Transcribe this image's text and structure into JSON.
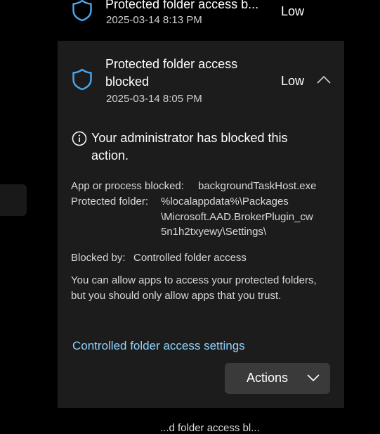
{
  "events": [
    {
      "title": "Protected folder access b...",
      "timestamp": "2025-03-14 8:13 PM",
      "severity": "Low",
      "icon": "shield-icon"
    },
    {
      "title": "Protected folder access blocked",
      "timestamp": "2025-03-14 8:05 PM",
      "severity": "Low",
      "icon": "shield-icon",
      "expanded": true
    }
  ],
  "detail": {
    "notice": "Your administrator has blocked this action.",
    "app_label": "App or process blocked:",
    "app_value": "backgroundTaskHost.exe",
    "folder_label": "Protected folder:",
    "folder_value_lines": [
      "%localappdata%\\Packages",
      "\\Microsoft.AAD.BrokerPlugin_cw",
      "5n1h2txyewy\\Settings\\"
    ],
    "blocked_by_label": "Blocked by:",
    "blocked_by_value": "Controlled folder access",
    "description": "You can allow apps to access your protected folders, but you should only allow apps that you trust.",
    "settings_link": "Controlled folder access settings",
    "actions_label": "Actions"
  },
  "colors": {
    "accent_link": "#8fd3ff",
    "shield": "#4aa8f0",
    "card_bg": "#1c1c1c"
  },
  "footer_peek": "...d folder access bl..."
}
